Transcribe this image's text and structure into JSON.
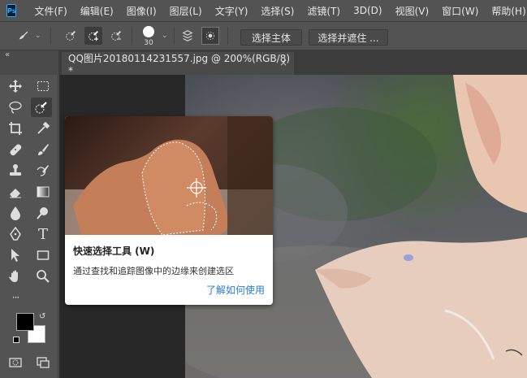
{
  "app": {
    "logo_text": "Ps"
  },
  "menu": {
    "items": [
      "文件(F)",
      "编辑(E)",
      "图像(I)",
      "图层(L)",
      "文字(Y)",
      "选择(S)",
      "滤镜(T)",
      "3D(D)",
      "视图(V)",
      "窗口(W)",
      "帮助(H)"
    ]
  },
  "options": {
    "brush_size": "30",
    "select_subject_label": "选择主体",
    "select_and_mask_label": "选择并遮住 ..."
  },
  "document": {
    "tab_title": "QQ图片20180114231557.jpg @ 200%(RGB/8) *",
    "close_glyph": "×"
  },
  "tooltip": {
    "title": "快速选择工具 (W)",
    "description": "通过查找和追踪图像中的边缘来创建选区",
    "link": "了解如何使用"
  },
  "toolbox": {
    "header_glyph": "«",
    "more_glyph": "···",
    "tools": [
      "move-tool-icon",
      "rect-marquee-icon",
      "lasso-icon",
      "quick-selection-icon",
      "crop-icon",
      "eyedropper-icon",
      "healing-brush-icon",
      "brush-icon",
      "clone-stamp-icon",
      "history-brush-icon",
      "eraser-icon",
      "gradient-icon",
      "blur-icon",
      "dodge-icon",
      "pen-icon",
      "type-icon",
      "path-select-icon",
      "rectangle-icon",
      "hand-icon",
      "zoom-icon"
    ],
    "type_glyph": "T"
  },
  "colors": {
    "foreground": "#000000",
    "background": "#ffffff",
    "ui_panel": "#535353",
    "canvas_bg": "#282828",
    "link": "#2b7bd6"
  }
}
